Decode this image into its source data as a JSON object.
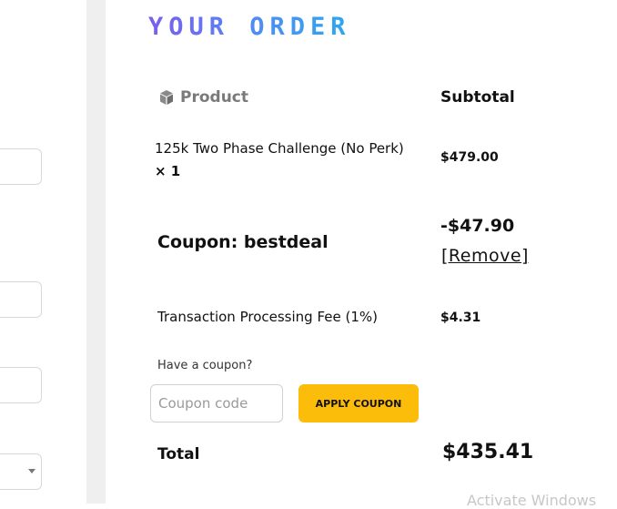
{
  "order": {
    "title": "YOUR ORDER",
    "header_product": "Product",
    "header_subtotal": "Subtotal",
    "item_name": "125k Two Phase Challenge (No Perk)",
    "item_qty": "× 1",
    "item_price": "$479.00",
    "coupon_label": "Coupon: bestdeal",
    "coupon_amount": "-$47.90",
    "coupon_remove": "[Remove]",
    "fee_label": "Transaction Processing Fee (1%)",
    "fee_value": "$4.31",
    "have_coupon": "Have a coupon?",
    "coupon_placeholder": "Coupon code",
    "apply_label": "APPLY COUPON",
    "total_label": "Total",
    "total_value": "$435.41",
    "title_gradient": [
      "#7b5cf0",
      "#4f8ef2",
      "#2aa8f0"
    ],
    "apply_color": "#fbbd0a"
  },
  "watermark": "Activate Windows",
  "icons": {
    "product": "package-icon",
    "select": "chevron-down-icon"
  }
}
